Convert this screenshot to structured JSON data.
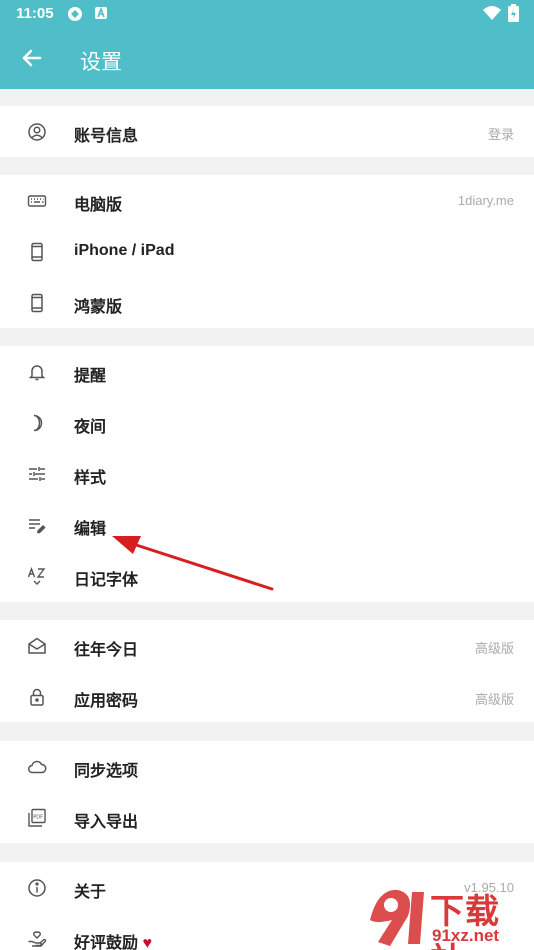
{
  "status_bar": {
    "time": "11:05"
  },
  "toolbar": {
    "title": "设置"
  },
  "groups": [
    {
      "items": [
        {
          "label": "账号信息",
          "value": "登录",
          "icon": "user-circle-icon"
        }
      ]
    },
    {
      "items": [
        {
          "label": "电脑版",
          "value": "1diary.me",
          "icon": "keyboard-icon"
        },
        {
          "label": "iPhone / iPad",
          "value": "",
          "icon": "phone-icon"
        },
        {
          "label": "鸿蒙版",
          "value": "",
          "icon": "phone-icon"
        }
      ]
    },
    {
      "items": [
        {
          "label": "提醒",
          "value": "",
          "icon": "bell-icon"
        },
        {
          "label": "夜间",
          "value": "",
          "icon": "moon-icon"
        },
        {
          "label": "样式",
          "value": "",
          "icon": "sliders-icon"
        },
        {
          "label": "编辑",
          "value": "",
          "icon": "edit-lines-icon"
        },
        {
          "label": "日记字体",
          "value": "",
          "icon": "font-az-icon"
        }
      ]
    },
    {
      "items": [
        {
          "label": "往年今日",
          "value": "高级版",
          "icon": "mail-open-icon"
        },
        {
          "label": "应用密码",
          "value": "高级版",
          "icon": "lock-icon"
        }
      ]
    },
    {
      "items": [
        {
          "label": "同步选项",
          "value": "",
          "icon": "cloud-icon"
        },
        {
          "label": "导入导出",
          "value": "",
          "icon": "pdf-file-icon"
        }
      ]
    },
    {
      "items": [
        {
          "label": "关于",
          "value": "v1.95.10",
          "icon": "info-icon"
        },
        {
          "label": "好评鼓励",
          "value": "",
          "icon": "hand-heart-icon",
          "heart": "♥"
        }
      ]
    }
  ],
  "watermark": {
    "big": "下载站",
    "small": "91xz.net"
  },
  "colors": {
    "appbar": "#4fbec8",
    "annotation_arrow": "#d62020"
  }
}
